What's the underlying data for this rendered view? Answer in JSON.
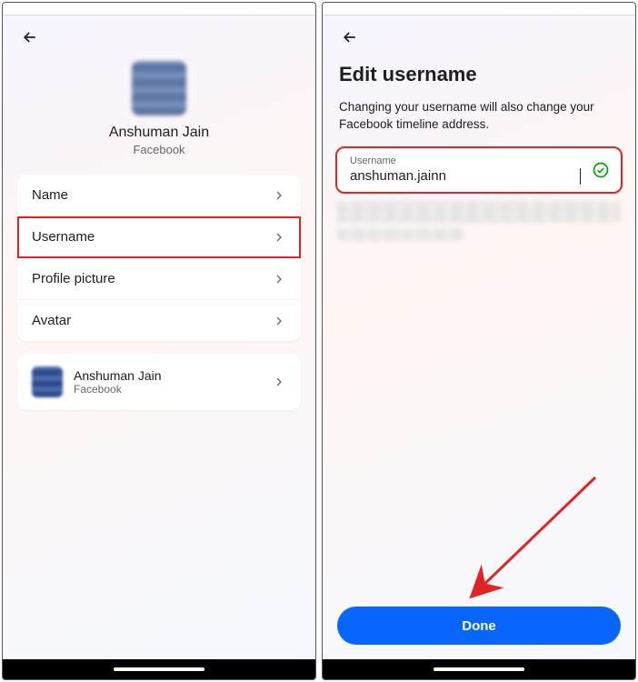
{
  "left": {
    "profile": {
      "name": "Anshuman Jain",
      "platform": "Facebook"
    },
    "menu": {
      "items": [
        {
          "label": "Name"
        },
        {
          "label": "Username"
        },
        {
          "label": "Profile picture"
        },
        {
          "label": "Avatar"
        }
      ]
    },
    "account": {
      "name": "Anshuman Jain",
      "platform": "Facebook"
    }
  },
  "right": {
    "title": "Edit username",
    "description": "Changing your username will also change your Facebook timeline address.",
    "field": {
      "label": "Username",
      "value": "anshuman.jainn"
    },
    "button": "Done"
  }
}
